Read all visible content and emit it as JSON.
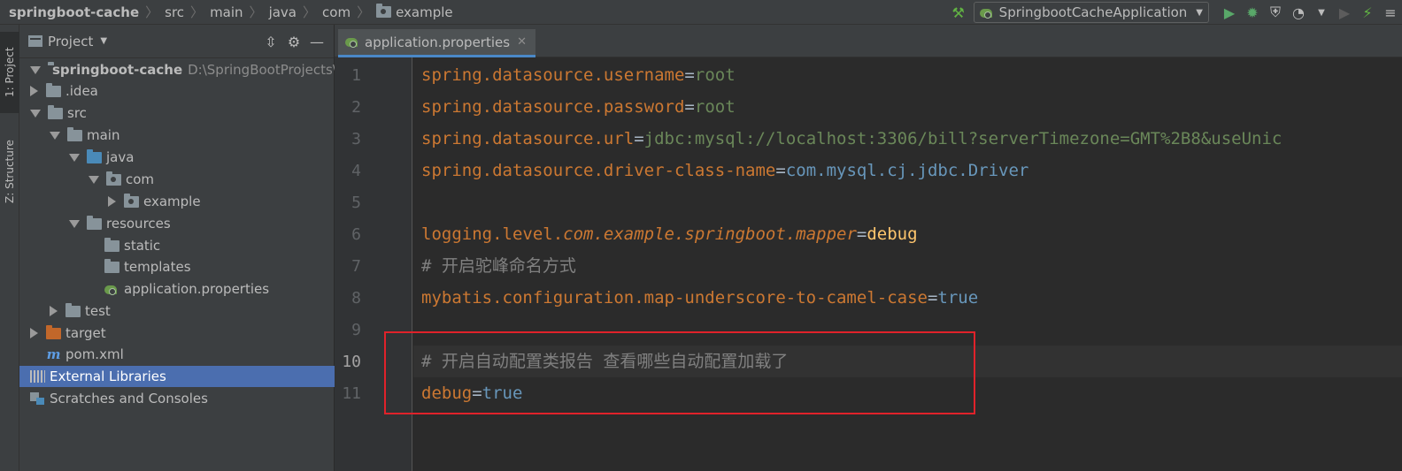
{
  "breadcrumb": [
    "springboot-cache",
    "src",
    "main",
    "java",
    "com",
    "example"
  ],
  "run_config": {
    "label": "SpringbootCacheApplication"
  },
  "left_stripe": {
    "project_tab": "1: Project",
    "structure_tab": "Z: Structure"
  },
  "project_panel": {
    "title": "Project"
  },
  "tree": [
    {
      "label": "springboot-cache",
      "path": "D:\\SpringBootProjects\\sp"
    },
    {
      "label": ".idea"
    },
    {
      "label": "src"
    },
    {
      "label": "main"
    },
    {
      "label": "java"
    },
    {
      "label": "com"
    },
    {
      "label": "example"
    },
    {
      "label": "resources"
    },
    {
      "label": "static"
    },
    {
      "label": "templates"
    },
    {
      "label": "application.properties"
    },
    {
      "label": "test"
    },
    {
      "label": "target"
    },
    {
      "label": "pom.xml"
    },
    {
      "label": "External Libraries"
    },
    {
      "label": "Scratches and Consoles"
    }
  ],
  "editor": {
    "tab_label": "application.properties",
    "current_line": 10,
    "lines": [
      {
        "n": "1",
        "key": "spring.datasource.username",
        "eq": "=",
        "val": "root"
      },
      {
        "n": "2",
        "key": "spring.datasource.password",
        "eq": "=",
        "val": "root"
      },
      {
        "n": "3",
        "key": "spring.datasource.url",
        "eq": "=",
        "val": "jdbc:mysql://localhost:3306/bill?serverTimezone=GMT%2B8&useUnic"
      },
      {
        "n": "4",
        "key": "spring.datasource.driver-class-name",
        "eq": "=",
        "val": "com.mysql.cj.jdbc.Driver"
      },
      {
        "n": "5"
      },
      {
        "n": "6",
        "key": "logging.level.",
        "key_italic": "com.example.springboot.mapper",
        "eq": "=",
        "val": "debug"
      },
      {
        "n": "7",
        "comment": "# 开启驼峰命名方式"
      },
      {
        "n": "8",
        "key": "mybatis.configuration.map-underscore-to-camel-case",
        "eq": "=",
        "val": "true"
      },
      {
        "n": "9"
      },
      {
        "n": "10",
        "comment": "# 开启自动配置类报告 查看哪些自动配置加载了"
      },
      {
        "n": "11",
        "key": "debug",
        "eq": "=",
        "val": "true"
      }
    ]
  },
  "colors": {
    "keyword": "#cc7832",
    "string": "#6a8759",
    "annotation_box": "#e0222a",
    "selection": "#4b6eaf"
  }
}
